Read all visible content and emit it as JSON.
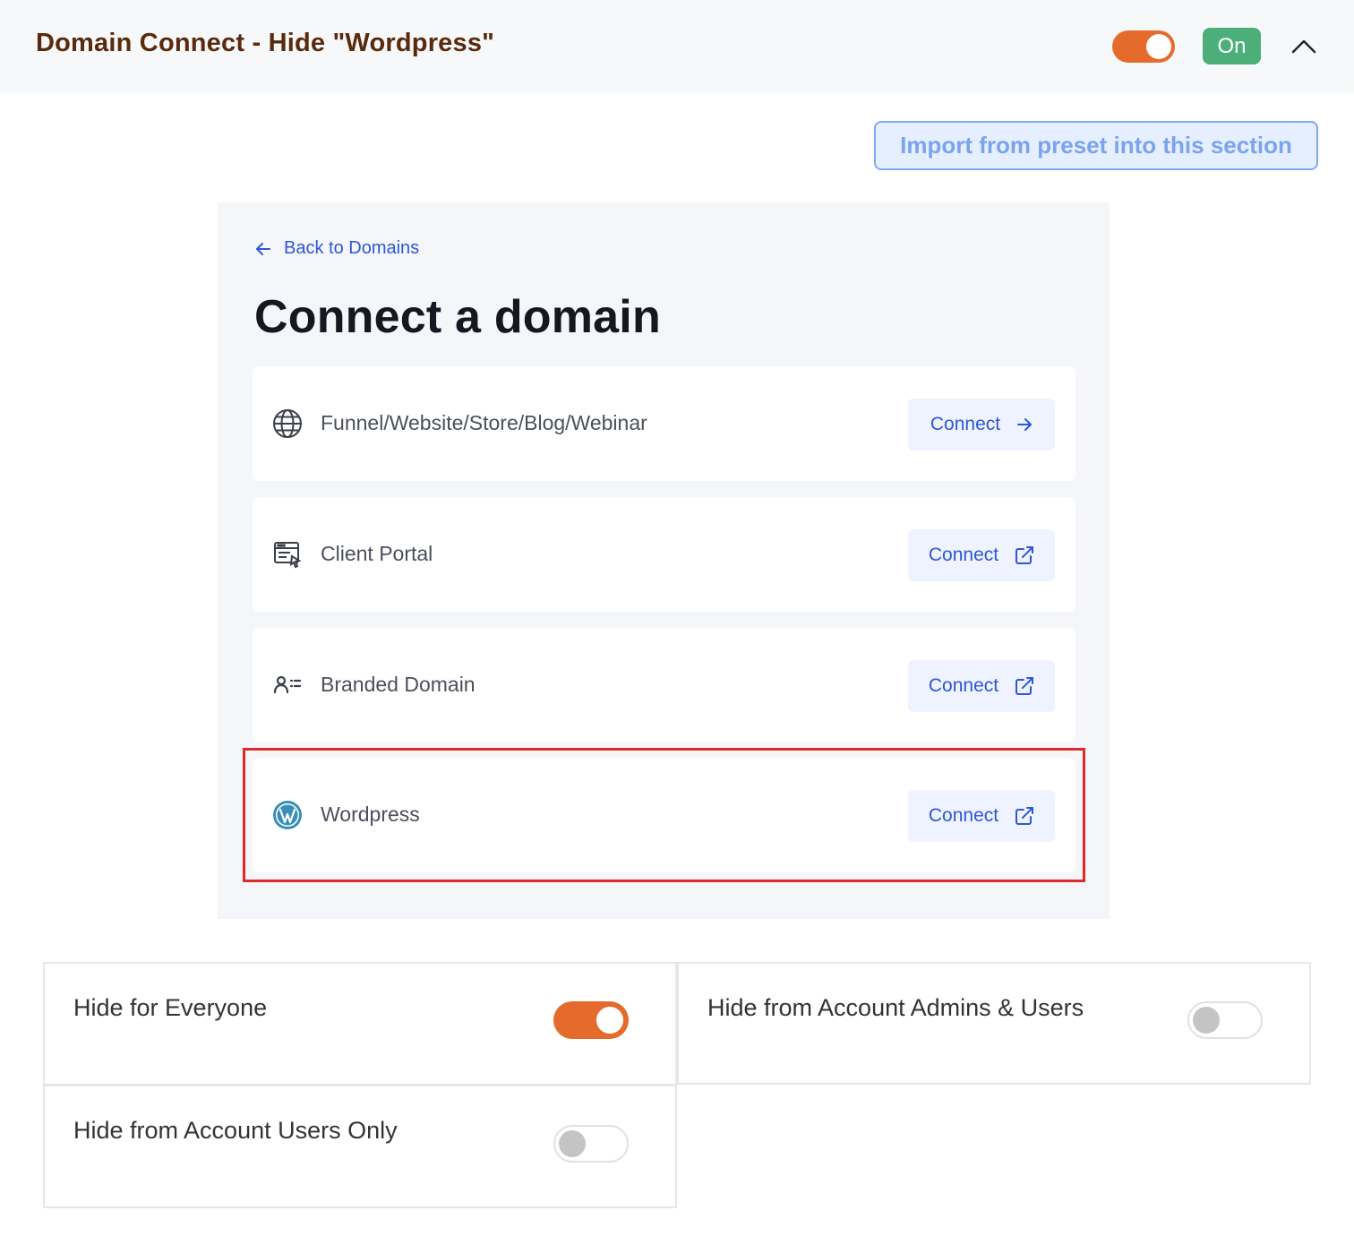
{
  "header": {
    "title": "Domain Connect - Hide \"Wordpress\"",
    "enabled": true,
    "status_label": "On"
  },
  "toolbar": {
    "import_label": "Import from preset into this section"
  },
  "preview": {
    "back_label": "Back to Domains",
    "title": "Connect a domain",
    "items": [
      {
        "label": "Funnel/Website/Store/Blog/Webinar",
        "icon": "globe-icon",
        "button": "Connect",
        "button_icon": "arrow-right-icon"
      },
      {
        "label": "Client Portal",
        "icon": "client-portal-icon",
        "button": "Connect",
        "button_icon": "external-link-icon"
      },
      {
        "label": "Branded Domain",
        "icon": "user-list-icon",
        "button": "Connect",
        "button_icon": "external-link-icon"
      },
      {
        "label": "Wordpress",
        "icon": "wordpress-icon",
        "button": "Connect",
        "button_icon": "external-link-icon",
        "highlighted": true
      }
    ]
  },
  "settings": [
    {
      "label": "Hide for Everyone",
      "enabled": true
    },
    {
      "label": "Hide from Account Admins & Users",
      "enabled": false
    },
    {
      "label": "Hide from Account Users Only",
      "enabled": false
    }
  ],
  "colors": {
    "accent_orange": "#e56b2c",
    "on_badge": "#4caf7a",
    "link_blue": "#2e56d8",
    "highlight_red": "#e02a2a",
    "title_brown": "#5a2a0c"
  }
}
